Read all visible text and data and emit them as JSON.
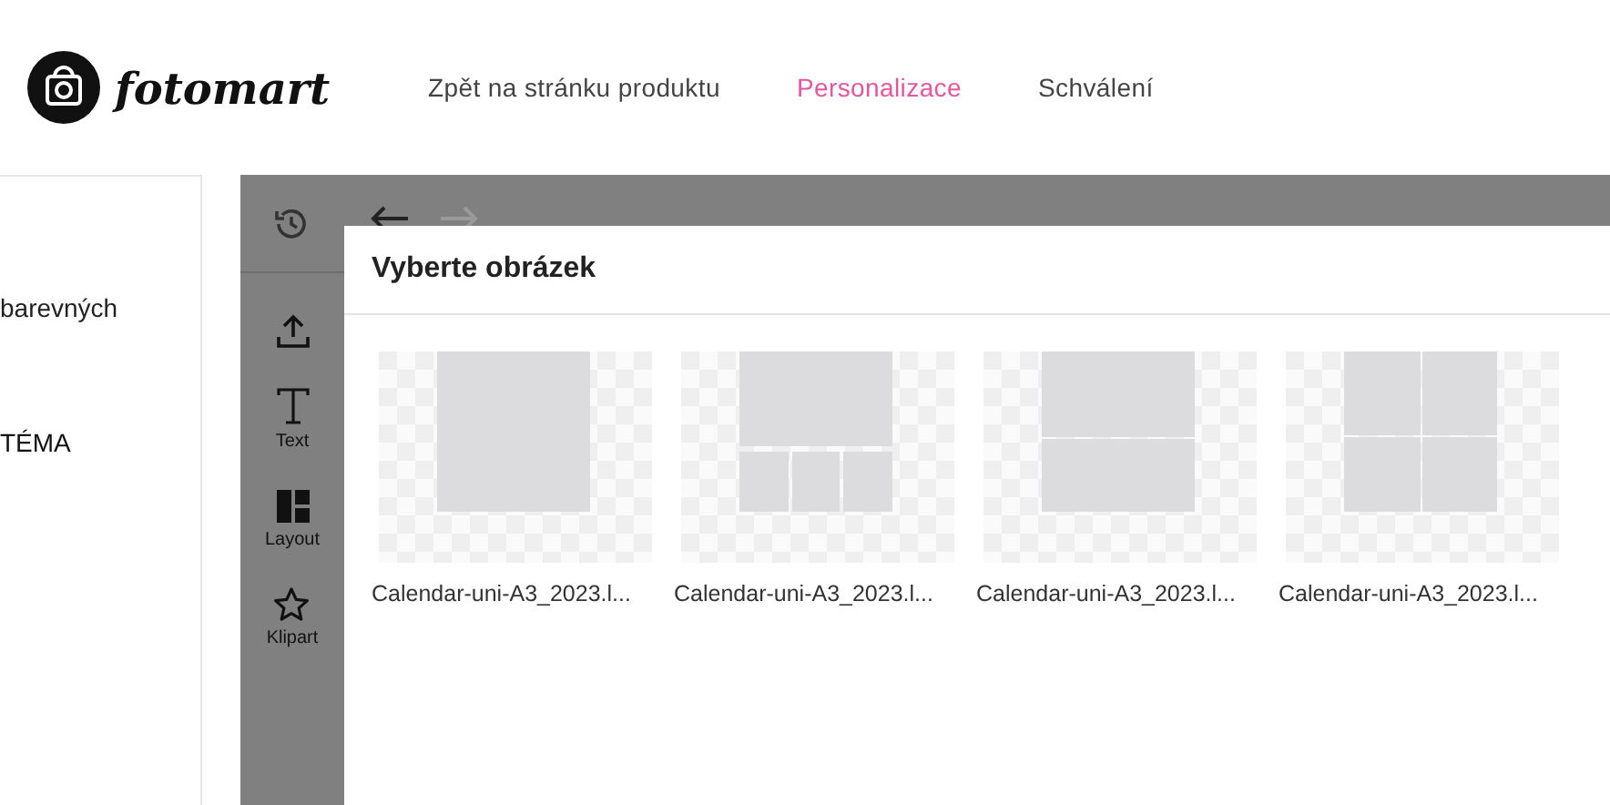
{
  "logo": {
    "text": "fotomart"
  },
  "nav": [
    {
      "label": "Zpět na stránku produktu",
      "selected": false
    },
    {
      "label": "Personalizace",
      "selected": true
    },
    {
      "label": "Schválení",
      "selected": false
    }
  ],
  "side_panel": {
    "items": [
      {
        "label": "barevných",
        "kind": "text"
      },
      {
        "label": "TÉMA",
        "kind": "heading"
      }
    ]
  },
  "editor_toolbar": {
    "redo_disabled": true
  },
  "tools": [
    {
      "kind": "upload"
    },
    {
      "kind": "text",
      "label": "Text"
    },
    {
      "kind": "layout",
      "label": "Layout"
    },
    {
      "kind": "clipart",
      "label": "Klipart"
    }
  ],
  "dialog": {
    "title": "Vyberte obrázek",
    "images": [
      {
        "kind": "single",
        "name": "Calendar-uni-A3_2023.l..."
      },
      {
        "kind": "top-three",
        "name": "Calendar-uni-A3_2023.l..."
      },
      {
        "kind": "two-rows",
        "name": "Calendar-uni-A3_2023.l..."
      },
      {
        "kind": "quad",
        "name": "Calendar-uni-A3_2023.l..."
      }
    ]
  }
}
